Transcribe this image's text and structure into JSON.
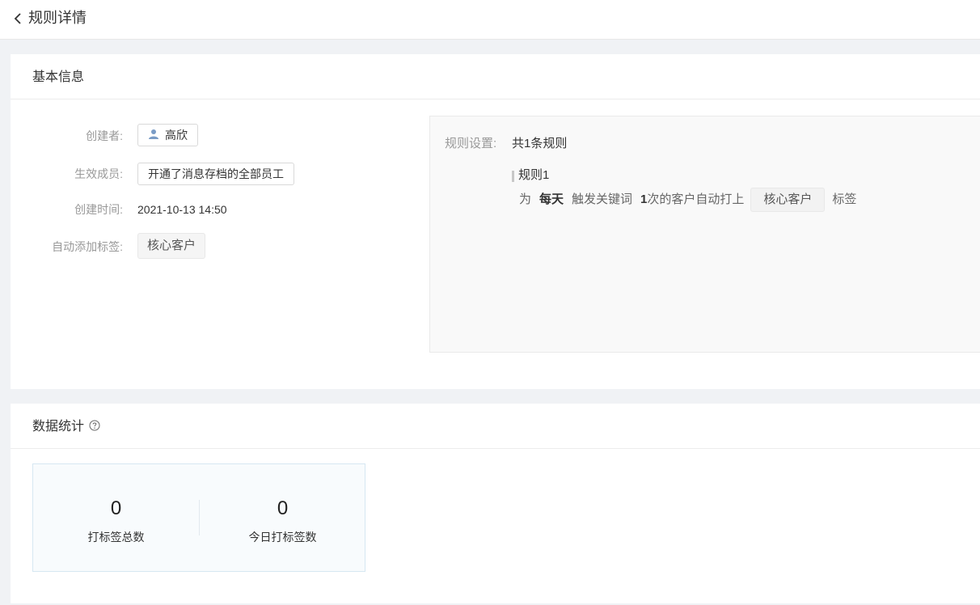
{
  "header": {
    "title": "规则详情",
    "back_icon": "chevron-left-icon"
  },
  "basic_info": {
    "title": "基本信息",
    "creator": {
      "label": "创建者:",
      "value": "高欣",
      "icon": "user-icon"
    },
    "members": {
      "label": "生效成员:",
      "value": "开通了消息存档的全部员工"
    },
    "created_time": {
      "label": "创建时间:",
      "value": "2021-10-13 14:50"
    },
    "auto_tag": {
      "label": "自动添加标签:",
      "value": "核心客户"
    },
    "rules": {
      "label": "规则设置:",
      "count": "共1条规则",
      "items": [
        {
          "name": "规则1",
          "prefix": "为",
          "frequency": "每天",
          "trigger": "触发关键词",
          "times": "1",
          "middle": "次的客户自动打上",
          "tag": "核心客户",
          "suffix": "标签"
        }
      ]
    }
  },
  "stats": {
    "title": "数据统计",
    "help_icon": "help-circle-icon",
    "items": [
      {
        "value": "0",
        "label": "打标签总数"
      },
      {
        "value": "0",
        "label": "今日打标签数"
      }
    ]
  },
  "colors": {
    "background": "#f0f2f5",
    "label_gray": "#999999",
    "stat_border": "#d6e7f2",
    "user_icon": "#7a9cc6"
  }
}
